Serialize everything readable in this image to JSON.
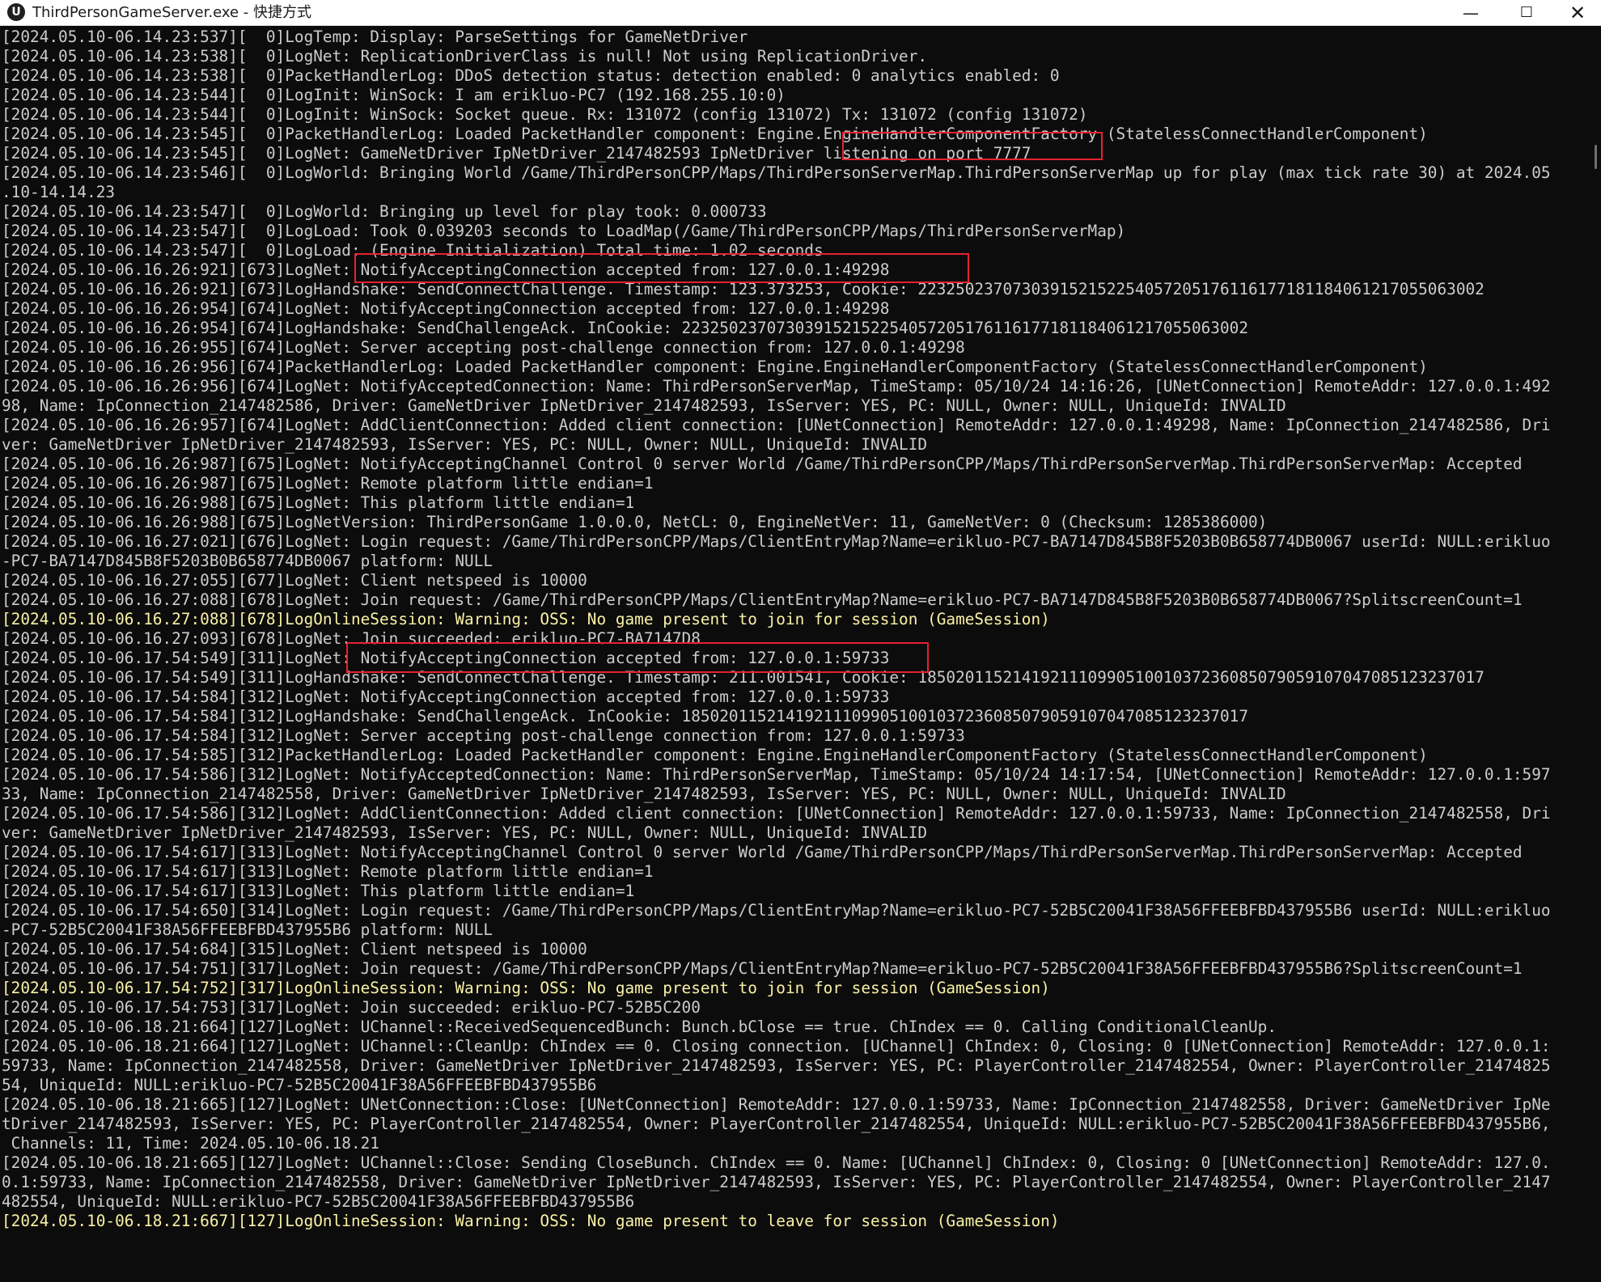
{
  "window": {
    "title": "ThirdPersonGameServer.exe - 快捷方式",
    "app_icon_label": "U",
    "controls": {
      "minimize": "—",
      "maximize": "☐",
      "close": "✕"
    }
  },
  "colors": {
    "background": "#0c0c0c",
    "text": "#cccccc",
    "warning_text": "#f9f1a5",
    "highlight_box": "#e8202e"
  },
  "console": {
    "lines": [
      {
        "text": "[2024.05.10-06.14.23:537][  0]LogTemp: Display: ParseSettings for GameNetDriver",
        "warn": false
      },
      {
        "text": "[2024.05.10-06.14.23:538][  0]LogNet: ReplicationDriverClass is null! Not using ReplicationDriver.",
        "warn": false
      },
      {
        "text": "[2024.05.10-06.14.23:538][  0]PacketHandlerLog: DDoS detection status: detection enabled: 0 analytics enabled: 0",
        "warn": false
      },
      {
        "text": "[2024.05.10-06.14.23:544][  0]LogInit: WinSock: I am erikluo-PC7 (192.168.255.10:0)",
        "warn": false
      },
      {
        "text": "[2024.05.10-06.14.23:544][  0]LogInit: WinSock: Socket queue. Rx: 131072 (config 131072) Tx: 131072 (config 131072)",
        "warn": false
      },
      {
        "text": "[2024.05.10-06.14.23:545][  0]PacketHandlerLog: Loaded PacketHandler component: Engine.EngineHandlerComponentFactory (StatelessConnectHandlerComponent)",
        "warn": false
      },
      {
        "text": "[2024.05.10-06.14.23:545][  0]LogNet: GameNetDriver IpNetDriver_2147482593 IpNetDriver listening on port 7777",
        "warn": false
      },
      {
        "text": "[2024.05.10-06.14.23:546][  0]LogWorld: Bringing World /Game/ThirdPersonCPP/Maps/ThirdPersonServerMap.ThirdPersonServerMap up for play (max tick rate 30) at 2024.05",
        "warn": false
      },
      {
        "text": ".10-14.14.23",
        "warn": false
      },
      {
        "text": "[2024.05.10-06.14.23:547][  0]LogWorld: Bringing up level for play took: 0.000733",
        "warn": false
      },
      {
        "text": "[2024.05.10-06.14.23:547][  0]LogLoad: Took 0.039203 seconds to LoadMap(/Game/ThirdPersonCPP/Maps/ThirdPersonServerMap)",
        "warn": false
      },
      {
        "text": "[2024.05.10-06.14.23:547][  0]LogLoad: (Engine Initialization) Total time: 1.02 seconds",
        "warn": false
      },
      {
        "text": "[2024.05.10-06.16.26:921][673]LogNet: NotifyAcceptingConnection accepted from: 127.0.0.1:49298",
        "warn": false
      },
      {
        "text": "[2024.05.10-06.16.26:921][673]LogHandshake: SendConnectChallenge. Timestamp: 123.373253, Cookie: 223250237073039152152254057205176116177181184061217055063002",
        "warn": false
      },
      {
        "text": "[2024.05.10-06.16.26:954][674]LogNet: NotifyAcceptingConnection accepted from: 127.0.0.1:49298",
        "warn": false
      },
      {
        "text": "[2024.05.10-06.16.26:954][674]LogHandshake: SendChallengeAck. InCookie: 223250237073039152152254057205176116177181184061217055063002",
        "warn": false
      },
      {
        "text": "[2024.05.10-06.16.26:955][674]LogNet: Server accepting post-challenge connection from: 127.0.0.1:49298",
        "warn": false
      },
      {
        "text": "[2024.05.10-06.16.26:956][674]PacketHandlerLog: Loaded PacketHandler component: Engine.EngineHandlerComponentFactory (StatelessConnectHandlerComponent)",
        "warn": false
      },
      {
        "text": "[2024.05.10-06.16.26:956][674]LogNet: NotifyAcceptedConnection: Name: ThirdPersonServerMap, TimeStamp: 05/10/24 14:16:26, [UNetConnection] RemoteAddr: 127.0.0.1:492",
        "warn": false
      },
      {
        "text": "98, Name: IpConnection_2147482586, Driver: GameNetDriver IpNetDriver_2147482593, IsServer: YES, PC: NULL, Owner: NULL, UniqueId: INVALID",
        "warn": false
      },
      {
        "text": "[2024.05.10-06.16.26:957][674]LogNet: AddClientConnection: Added client connection: [UNetConnection] RemoteAddr: 127.0.0.1:49298, Name: IpConnection_2147482586, Dri",
        "warn": false
      },
      {
        "text": "ver: GameNetDriver IpNetDriver_2147482593, IsServer: YES, PC: NULL, Owner: NULL, UniqueId: INVALID",
        "warn": false
      },
      {
        "text": "[2024.05.10-06.16.26:987][675]LogNet: NotifyAcceptingChannel Control 0 server World /Game/ThirdPersonCPP/Maps/ThirdPersonServerMap.ThirdPersonServerMap: Accepted",
        "warn": false
      },
      {
        "text": "[2024.05.10-06.16.26:987][675]LogNet: Remote platform little endian=1",
        "warn": false
      },
      {
        "text": "[2024.05.10-06.16.26:988][675]LogNet: This platform little endian=1",
        "warn": false
      },
      {
        "text": "[2024.05.10-06.16.26:988][675]LogNetVersion: ThirdPersonGame 1.0.0.0, NetCL: 0, EngineNetVer: 11, GameNetVer: 0 (Checksum: 1285386000)",
        "warn": false
      },
      {
        "text": "[2024.05.10-06.16.27:021][676]LogNet: Login request: /Game/ThirdPersonCPP/Maps/ClientEntryMap?Name=erikluo-PC7-BA7147D845B8F5203B0B658774DB0067 userId: NULL:erikluo",
        "warn": false
      },
      {
        "text": "-PC7-BA7147D845B8F5203B0B658774DB0067 platform: NULL",
        "warn": false
      },
      {
        "text": "[2024.05.10-06.16.27:055][677]LogNet: Client netspeed is 10000",
        "warn": false
      },
      {
        "text": "[2024.05.10-06.16.27:088][678]LogNet: Join request: /Game/ThirdPersonCPP/Maps/ClientEntryMap?Name=erikluo-PC7-BA7147D845B8F5203B0B658774DB0067?SplitscreenCount=1",
        "warn": false
      },
      {
        "text": "[2024.05.10-06.16.27:088][678]LogOnlineSession: Warning: OSS: No game present to join for session (GameSession)",
        "warn": true
      },
      {
        "text": "[2024.05.10-06.16.27:093][678]LogNet: Join succeeded: erikluo-PC7-BA7147D8",
        "warn": false
      },
      {
        "text": "[2024.05.10-06.17.54:549][311]LogNet: NotifyAcceptingConnection accepted from: 127.0.0.1:59733",
        "warn": false
      },
      {
        "text": "[2024.05.10-06.17.54:549][311]LogHandshake: SendConnectChallenge. Timestamp: 211.001541, Cookie: 185020115214192111099051001037236085079059107047085123237017",
        "warn": false
      },
      {
        "text": "[2024.05.10-06.17.54:584][312]LogNet: NotifyAcceptingConnection accepted from: 127.0.0.1:59733",
        "warn": false
      },
      {
        "text": "[2024.05.10-06.17.54:584][312]LogHandshake: SendChallengeAck. InCookie: 185020115214192111099051001037236085079059107047085123237017",
        "warn": false
      },
      {
        "text": "[2024.05.10-06.17.54:584][312]LogNet: Server accepting post-challenge connection from: 127.0.0.1:59733",
        "warn": false
      },
      {
        "text": "[2024.05.10-06.17.54:585][312]PacketHandlerLog: Loaded PacketHandler component: Engine.EngineHandlerComponentFactory (StatelessConnectHandlerComponent)",
        "warn": false
      },
      {
        "text": "[2024.05.10-06.17.54:586][312]LogNet: NotifyAcceptedConnection: Name: ThirdPersonServerMap, TimeStamp: 05/10/24 14:17:54, [UNetConnection] RemoteAddr: 127.0.0.1:597",
        "warn": false
      },
      {
        "text": "33, Name: IpConnection_2147482558, Driver: GameNetDriver IpNetDriver_2147482593, IsServer: YES, PC: NULL, Owner: NULL, UniqueId: INVALID",
        "warn": false
      },
      {
        "text": "[2024.05.10-06.17.54:586][312]LogNet: AddClientConnection: Added client connection: [UNetConnection] RemoteAddr: 127.0.0.1:59733, Name: IpConnection_2147482558, Dri",
        "warn": false
      },
      {
        "text": "ver: GameNetDriver IpNetDriver_2147482593, IsServer: YES, PC: NULL, Owner: NULL, UniqueId: INVALID",
        "warn": false
      },
      {
        "text": "[2024.05.10-06.17.54:617][313]LogNet: NotifyAcceptingChannel Control 0 server World /Game/ThirdPersonCPP/Maps/ThirdPersonServerMap.ThirdPersonServerMap: Accepted",
        "warn": false
      },
      {
        "text": "[2024.05.10-06.17.54:617][313]LogNet: Remote platform little endian=1",
        "warn": false
      },
      {
        "text": "[2024.05.10-06.17.54:617][313]LogNet: This platform little endian=1",
        "warn": false
      },
      {
        "text": "[2024.05.10-06.17.54:650][314]LogNet: Login request: /Game/ThirdPersonCPP/Maps/ClientEntryMap?Name=erikluo-PC7-52B5C20041F38A56FFEEBFBD437955B6 userId: NULL:erikluo",
        "warn": false
      },
      {
        "text": "-PC7-52B5C20041F38A56FFEEBFBD437955B6 platform: NULL",
        "warn": false
      },
      {
        "text": "[2024.05.10-06.17.54:684][315]LogNet: Client netspeed is 10000",
        "warn": false
      },
      {
        "text": "[2024.05.10-06.17.54:751][317]LogNet: Join request: /Game/ThirdPersonCPP/Maps/ClientEntryMap?Name=erikluo-PC7-52B5C20041F38A56FFEEBFBD437955B6?SplitscreenCount=1",
        "warn": false
      },
      {
        "text": "[2024.05.10-06.17.54:752][317]LogOnlineSession: Warning: OSS: No game present to join for session (GameSession)",
        "warn": true
      },
      {
        "text": "[2024.05.10-06.17.54:753][317]LogNet: Join succeeded: erikluo-PC7-52B5C200",
        "warn": false
      },
      {
        "text": "[2024.05.10-06.18.21:664][127]LogNet: UChannel::ReceivedSequencedBunch: Bunch.bClose == true. ChIndex == 0. Calling ConditionalCleanUp.",
        "warn": false
      },
      {
        "text": "[2024.05.10-06.18.21:664][127]LogNet: UChannel::CleanUp: ChIndex == 0. Closing connection. [UChannel] ChIndex: 0, Closing: 0 [UNetConnection] RemoteAddr: 127.0.0.1:",
        "warn": false
      },
      {
        "text": "59733, Name: IpConnection_2147482558, Driver: GameNetDriver IpNetDriver_2147482593, IsServer: YES, PC: PlayerController_2147482554, Owner: PlayerController_21474825",
        "warn": false
      },
      {
        "text": "54, UniqueId: NULL:erikluo-PC7-52B5C20041F38A56FFEEBFBD437955B6",
        "warn": false
      },
      {
        "text": "[2024.05.10-06.18.21:665][127]LogNet: UNetConnection::Close: [UNetConnection] RemoteAddr: 127.0.0.1:59733, Name: IpConnection_2147482558, Driver: GameNetDriver IpNe",
        "warn": false
      },
      {
        "text": "tDriver_2147482593, IsServer: YES, PC: PlayerController_2147482554, Owner: PlayerController_2147482554, UniqueId: NULL:erikluo-PC7-52B5C20041F38A56FFEEBFBD437955B6,",
        "warn": false
      },
      {
        "text": " Channels: 11, Time: 2024.05.10-06.18.21",
        "warn": false
      },
      {
        "text": "[2024.05.10-06.18.21:665][127]LogNet: UChannel::Close: Sending CloseBunch. ChIndex == 0. Name: [UChannel] ChIndex: 0, Closing: 0 [UNetConnection] RemoteAddr: 127.0.",
        "warn": false
      },
      {
        "text": "0.1:59733, Name: IpConnection_2147482558, Driver: GameNetDriver IpNetDriver_2147482593, IsServer: YES, PC: PlayerController_2147482554, Owner: PlayerController_2147",
        "warn": false
      },
      {
        "text": "482554, UniqueId: NULL:erikluo-PC7-52B5C20041F38A56FFEEBFBD437955B6",
        "warn": false
      },
      {
        "text": "[2024.05.10-06.18.21:667][127]LogOnlineSession: Warning: OSS: No game present to leave for session (GameSession)",
        "warn": true
      }
    ]
  }
}
